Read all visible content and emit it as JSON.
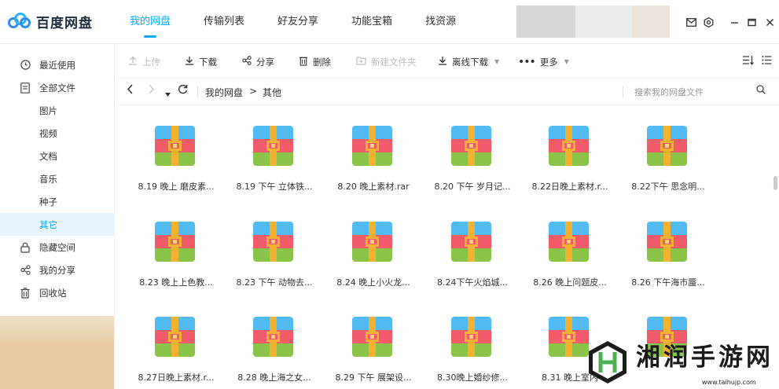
{
  "app": {
    "logo_text": "百度网盘"
  },
  "nav": {
    "tabs": [
      {
        "label": "我的网盘",
        "active": true
      },
      {
        "label": "传输列表"
      },
      {
        "label": "好友分享"
      },
      {
        "label": "功能宝箱"
      },
      {
        "label": "找资源"
      }
    ]
  },
  "window_controls": [
    "mail-icon",
    "settings-icon",
    "minimize-icon",
    "maximize-icon",
    "close-icon"
  ],
  "sidebar": {
    "items": [
      {
        "label": "最近使用",
        "icon": "clock-icon"
      },
      {
        "label": "全部文件",
        "icon": "file-icon"
      },
      {
        "label": "图片"
      },
      {
        "label": "视频"
      },
      {
        "label": "文档"
      },
      {
        "label": "音乐"
      },
      {
        "label": "种子"
      },
      {
        "label": "其它",
        "active": true
      },
      {
        "label": "隐藏空间",
        "icon": "lock-icon"
      },
      {
        "label": "我的分享",
        "icon": "share-icon"
      },
      {
        "label": "回收站",
        "icon": "trash-icon"
      }
    ]
  },
  "toolbar": {
    "upload": "上传",
    "download": "下载",
    "share": "分享",
    "delete": "删除",
    "new_folder": "新建文件夹",
    "offline_download": "离线下载",
    "more": "更多"
  },
  "breadcrumb": {
    "root": "我的网盘",
    "separator": ">",
    "current": "其他"
  },
  "search": {
    "placeholder": "搜索我的网盘文件"
  },
  "files": [
    "8.19 晚上 磨皮素...",
    "8.19 下午 立体铁...",
    "8.20 晚上素材.rar",
    "8.20 下午 岁月记...",
    "8.22日晚上素材.r...",
    "8.22下午 思念明...",
    "8.23 晚上上色教...",
    "8.23 下午 动物去...",
    "8.24 晚上小火龙...",
    "8.24下午火焰城...",
    "8.26 晚上问题皮...",
    "8.26 下午海市蜃...",
    "8.27日晚上素材.r...",
    "8.28 晚上海之女...",
    "8.29 下午 展架设...",
    "8.30晚上婚纱修...",
    "8.31 晚上室内",
    ""
  ],
  "watermark": {
    "text": "湘润手游网",
    "url": "www.taihujp.com"
  },
  "colors": {
    "accent": "#06a7ff",
    "rar_blue": "#52bbf4",
    "rar_red": "#f25c6a",
    "rar_green": "#8ac449",
    "rar_strap": "#f3b231"
  }
}
